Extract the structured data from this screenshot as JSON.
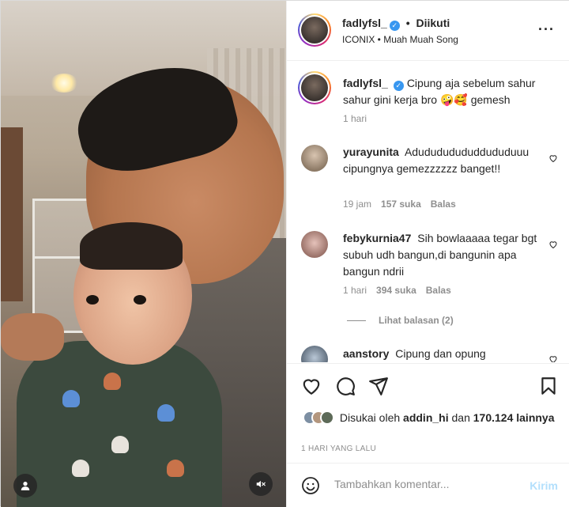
{
  "post": {
    "author": "fadlyfsl_",
    "follow_status": "Diikuti",
    "separator": "•",
    "music": "ICONIX • Muah Muah Song"
  },
  "caption": {
    "username": "fadlyfsl_",
    "text": "Cipung aja sebelum sahur sahur gini kerja bro 🤪🥰 gemesh",
    "time": "1 hari"
  },
  "comments": [
    {
      "username": "yurayunita",
      "text": "Adudududududdududuuu cipungnya gemezzzzzz banget!!",
      "time": "19 jam",
      "likes": "157 suka",
      "reply": "Balas"
    },
    {
      "username": "febykurnia47",
      "text": "Sih bowlaaaaa tegar bgt subuh udh bangun,di bangunin apa bangun ndrii",
      "time": "1 hari",
      "likes": "394 suka",
      "reply": "Balas",
      "view_replies": "Lihat balasan (2)"
    },
    {
      "username": "aanstory",
      "text": "Cipung dan opung"
    }
  ],
  "likes": {
    "prefix": "Disukai oleh",
    "user": "addin_hi",
    "middle": "dan",
    "count": "170.124",
    "suffix": "lainnya"
  },
  "post_time": "1 HARI YANG LALU",
  "composer": {
    "placeholder": "Tambahkan komentar...",
    "send_label": "Kirim"
  },
  "colors": {
    "verified": "#3897f0",
    "send_disabled": "#b2dffc",
    "muted_text": "#8e8e8e"
  },
  "icons": [
    "verified-badge-icon",
    "more-options-icon",
    "heart-icon",
    "comment-icon",
    "share-icon",
    "bookmark-icon",
    "emoji-icon",
    "user-tag-icon",
    "mute-icon"
  ]
}
